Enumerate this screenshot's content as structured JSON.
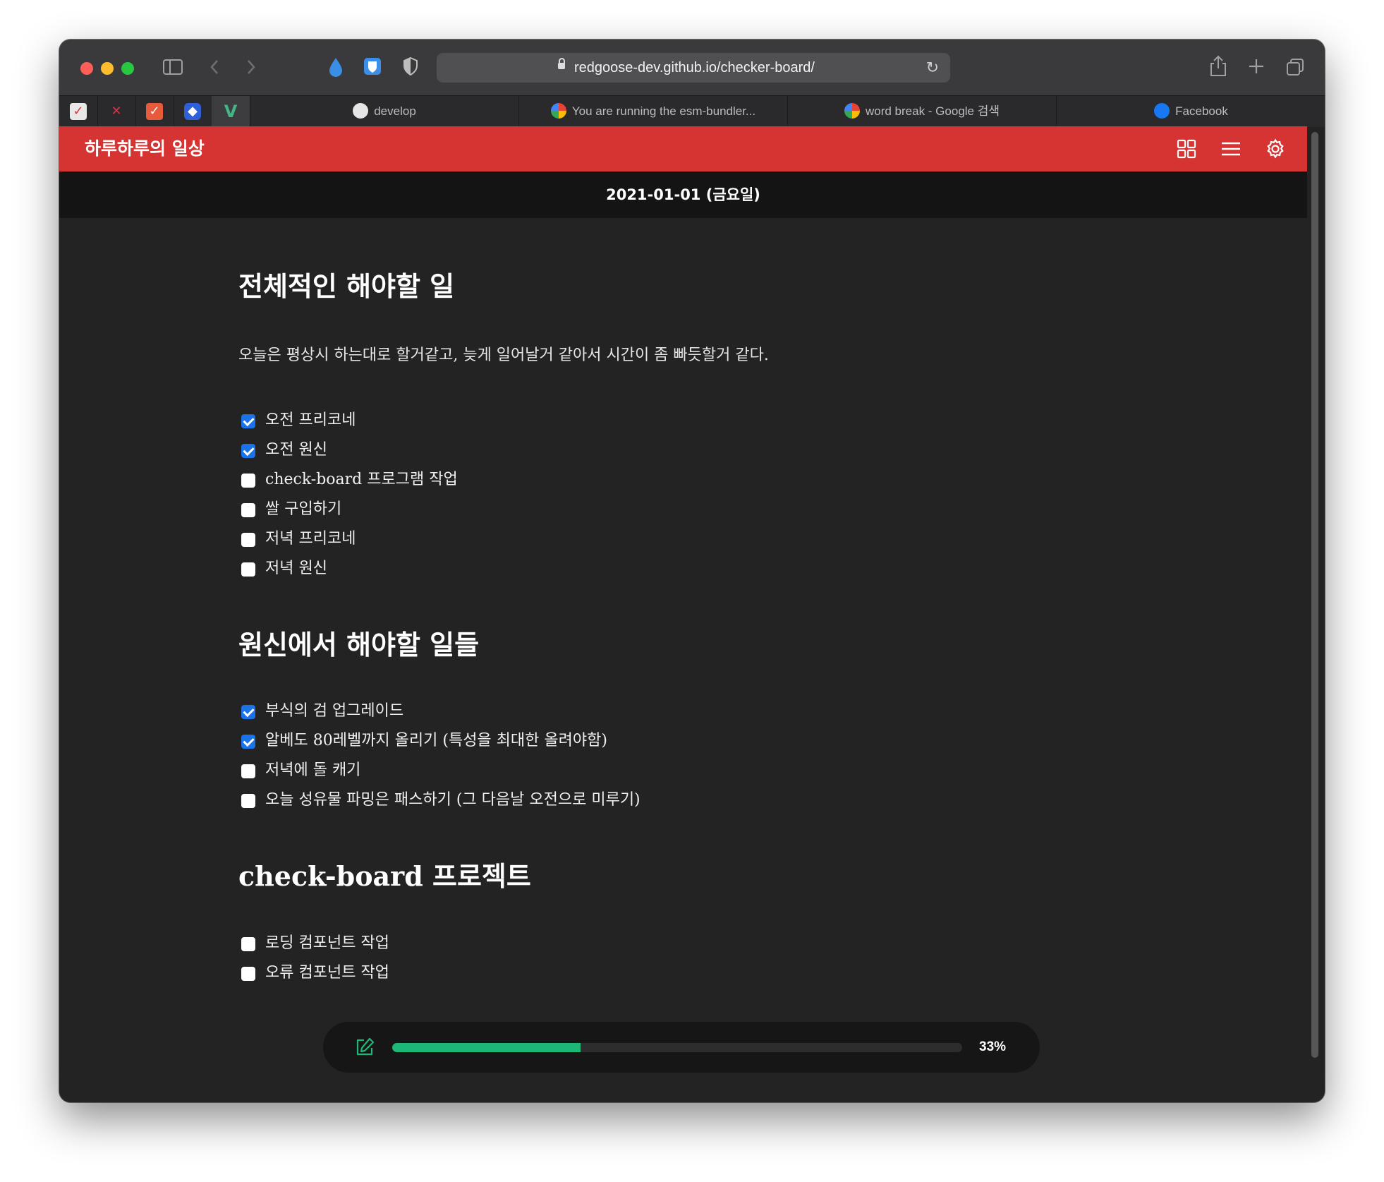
{
  "browser": {
    "url": "redgoose-dev.github.io/checker-board/",
    "tabs": [
      {
        "label": "develop"
      },
      {
        "label": "You are running the esm-bundler..."
      },
      {
        "label": "word break - Google 검색"
      },
      {
        "label": "Facebook"
      }
    ]
  },
  "app": {
    "title": "하루하루의 일상",
    "date": "2021-01-01 (금요일)"
  },
  "sections": [
    {
      "heading": "전체적인 해야할 일",
      "description": "오늘은 평상시 하는대로 할거같고, 늦게 일어날거 같아서 시간이 좀 빠듯할거 같다.",
      "items": [
        {
          "label": "오전 프리코네",
          "checked": true
        },
        {
          "label": "오전 원신",
          "checked": true
        },
        {
          "label": "check-board 프로그램 작업",
          "checked": false
        },
        {
          "label": "쌀 구입하기",
          "checked": false
        },
        {
          "label": "저녁 프리코네",
          "checked": false
        },
        {
          "label": "저녁 원신",
          "checked": false
        }
      ]
    },
    {
      "heading": "원신에서 해야할 일들",
      "items": [
        {
          "label": "부식의 검 업그레이드",
          "checked": true
        },
        {
          "label": "알베도 80레벨까지 올리기 (특성을 최대한 올려야함)",
          "checked": true
        },
        {
          "label": "저녁에 돌 캐기",
          "checked": false
        },
        {
          "label": "오늘 성유물 파밍은 패스하기 (그 다음날 오전으로 미루기)",
          "checked": false
        }
      ]
    },
    {
      "heading": "check-board 프로젝트",
      "items": [
        {
          "label": "로딩 컴포넌트 작업",
          "checked": false
        },
        {
          "label": "오류 컴포넌트 작업",
          "checked": false
        }
      ]
    }
  ],
  "progress": {
    "percent": 33,
    "label": "33%"
  },
  "colors": {
    "header": "#d63333",
    "progress_fill": "#1db877",
    "checkbox_checked": "#1a73e8"
  },
  "icons": {
    "header": [
      "grid-icon",
      "menu-icon",
      "gear-icon"
    ],
    "progress": "edit-icon"
  }
}
